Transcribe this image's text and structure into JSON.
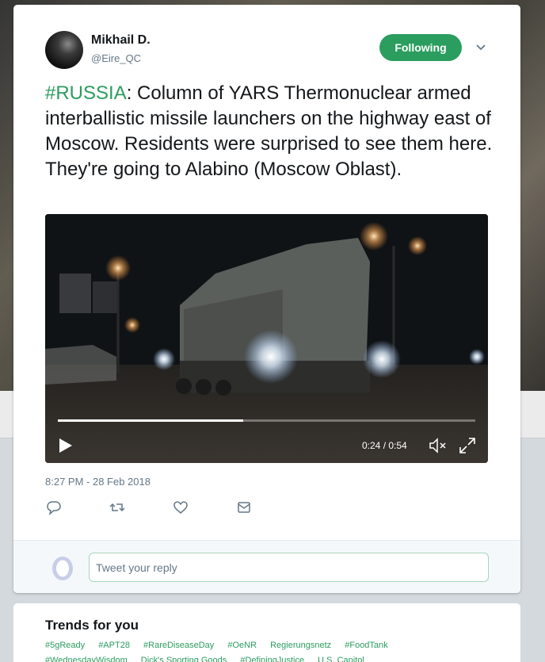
{
  "tweet": {
    "display_name": "Mikhail D.",
    "handle": "@Eire_QC",
    "follow_label": "Following",
    "hashtag": "#RUSSIA",
    "text": ": Column of YARS Thermonuclear armed interballistic missile launchers on the highway east of Moscow. Residents were surprised to see them here. They're going to Alabino (Moscow Oblast).",
    "timestamp": "8:27 PM - 28 Feb 2018"
  },
  "video": {
    "time_readout": "0:24 / 0:54",
    "progress_fraction": 0.444
  },
  "reply": {
    "placeholder": "Tweet your reply"
  },
  "trends": {
    "title": "Trends for you",
    "row1": [
      "#5gReady",
      "#APT28",
      "#RareDiseaseDay",
      "#OeNR",
      "Regierungsnetz",
      "#FoodTank"
    ],
    "row2": [
      "#WednesdayWisdom",
      "Dick's Sporting Goods",
      "#DefiningJustice",
      "U.S. Capitol"
    ]
  },
  "colors": {
    "accent": "#2b9d5f",
    "text": "#14171a",
    "muted": "#657786"
  },
  "icons": [
    "chevron-down-icon",
    "play-icon",
    "mute-icon",
    "fullscreen-icon",
    "reply-icon",
    "retweet-icon",
    "like-icon",
    "message-icon",
    "egg-avatar-icon"
  ]
}
